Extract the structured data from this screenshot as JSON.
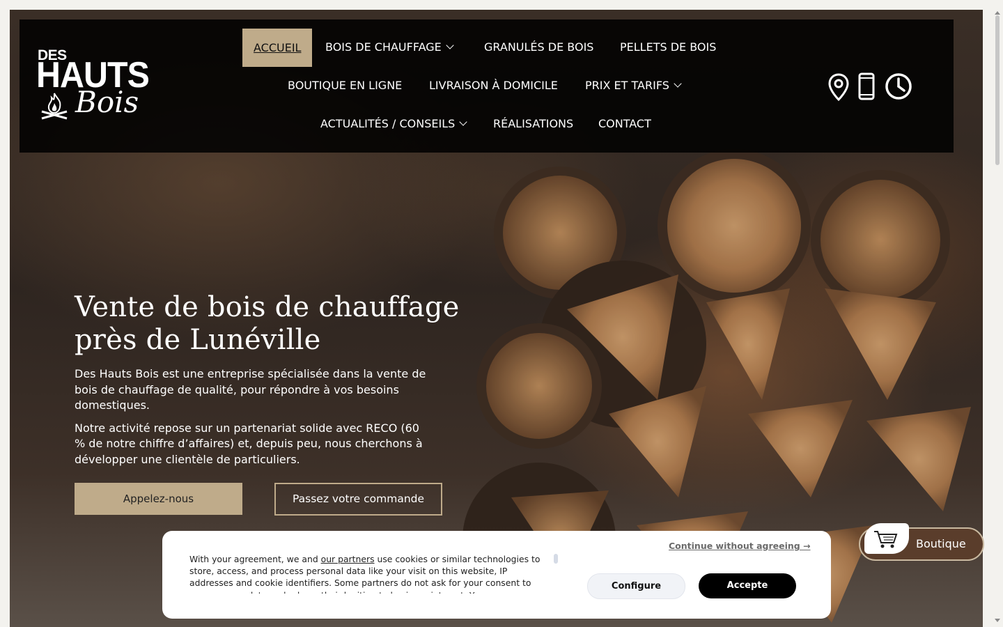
{
  "brand": {
    "logo_top": "DES",
    "logo_main": "HAUTS",
    "logo_script": "Bois"
  },
  "nav": {
    "items": [
      {
        "label": "ACCUEIL",
        "active": true,
        "has_submenu": false
      },
      {
        "label": "BOIS DE CHAUFFAGE",
        "active": false,
        "has_submenu": true
      },
      {
        "label": "GRANULÉS DE BOIS",
        "active": false,
        "has_submenu": false
      },
      {
        "label": "PELLETS DE BOIS",
        "active": false,
        "has_submenu": false
      },
      {
        "label": "BOUTIQUE EN LIGNE",
        "active": false,
        "has_submenu": false
      },
      {
        "label": "LIVRAISON À DOMICILE",
        "active": false,
        "has_submenu": false
      },
      {
        "label": "PRIX ET TARIFS",
        "active": false,
        "has_submenu": true
      },
      {
        "label": "ACTUALITÉS / CONSEILS",
        "active": false,
        "has_submenu": true
      },
      {
        "label": "RÉALISATIONS",
        "active": false,
        "has_submenu": false
      },
      {
        "label": "CONTACT",
        "active": false,
        "has_submenu": false
      }
    ],
    "active_color": "#bfab8a"
  },
  "header_icons": [
    "location-pin-icon",
    "mobile-phone-icon",
    "clock-icon"
  ],
  "hero": {
    "title_line1": "Vente de bois de chauffage",
    "title_line2": "près de Lunéville",
    "paragraph1": "Des Hauts Bois est une entreprise spécialisée dans la vente de bois de chauffage de qualité, pour répondre à vos besoins domestiques.",
    "paragraph2": "Notre activité repose sur un partenariat solide avec RECO (60 % de notre chiffre d’affaires) et, depuis peu, nous cherchons à développer une clientèle de particuliers.",
    "call_button": "Appelez-nous",
    "order_button": "Passez votre commande"
  },
  "cookie_banner": {
    "text_before_link": "With your agreement, we and ",
    "link_text": "our partners",
    "text_after_link": " use cookies or similar technologies to store, access, and process personal data like your visit on this website, IP addresses and cookie identifiers. Some partners do not ask for your consent to process your data and rely on their legitimate business interest. You can",
    "continue_link": "Continue without agreeing →",
    "configure_button": "Configure",
    "accept_button": "Accepte"
  },
  "floating_shop": {
    "label": "Boutique",
    "icon": "shopping-cart-icon",
    "color": "#5a3d2b"
  }
}
